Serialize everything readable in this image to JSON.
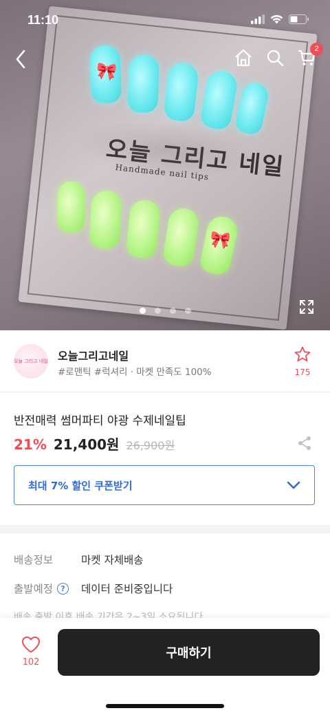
{
  "status_bar": {
    "time": "11:10"
  },
  "hero": {
    "card_title": "오늘 그리고 네일",
    "card_subtitle": "Handmade nail tips",
    "slide_count": 4,
    "active_slide": 1
  },
  "nav": {
    "cart_count": "2"
  },
  "seller": {
    "name": "오늘그리고네일",
    "tags": "#로맨틱 #럭셔리 · 마켓 만족도 100%",
    "avatar_text": "오늘 그리고 네일",
    "favorite_count": "175"
  },
  "product": {
    "title": "반전매력 썸머파티 야광 수제네일팁",
    "discount": "21%",
    "price": "21,400원",
    "original_price": "26,900원"
  },
  "coupon": {
    "label": "최대 7% 할인 쿠폰받기"
  },
  "shipping": {
    "delivery_label": "배송정보",
    "delivery_value": "마켓 자체배송",
    "departure_label": "출발예정",
    "departure_value": "데이터 준비중입니다",
    "note": "배송 출발 이후 배송 기간은 2~3일 소요됩니다"
  },
  "bottom": {
    "like_count": "102",
    "buy_label": "구매하기"
  },
  "colors": {
    "accent_red": "#ee4e56",
    "accent_blue": "#4b7fe4",
    "buy_button": "#222222"
  }
}
